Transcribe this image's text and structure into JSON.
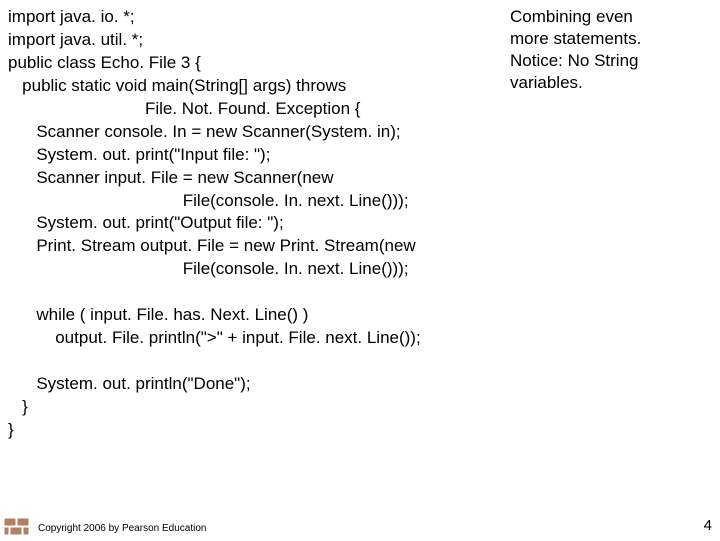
{
  "annotation": {
    "line1": "Combining even",
    "line2": "more statements.",
    "line3": "Notice: No String",
    "line4": "variables."
  },
  "code": {
    "l01": "import java. io. *;",
    "l02": "import java. util. *;",
    "l03": "public class Echo. File 3 {",
    "l04": "   public static void main(String[] args) throws",
    "l05": "                             File. Not. Found. Exception {",
    "l06": "      Scanner console. In = new Scanner(System. in);",
    "l07": "      System. out. print(\"Input file: \");",
    "l08": "      Scanner input. File = new Scanner(new",
    "l09": "                                     File(console. In. next. Line()));",
    "l10": "      System. out. print(\"Output file: \");",
    "l11": "      Print. Stream output. File = new Print. Stream(new",
    "l12": "                                     File(console. In. next. Line()));",
    "blank1": "",
    "l13": "      while ( input. File. has. Next. Line() )",
    "l14": "          output. File. println(\">\" + input. File. next. Line());",
    "blank2": "",
    "l15": "      System. out. println(\"Done\");",
    "l16": "   }",
    "l17": "}"
  },
  "footer": {
    "copyright": "Copyright 2006 by Pearson Education",
    "page": "4"
  }
}
